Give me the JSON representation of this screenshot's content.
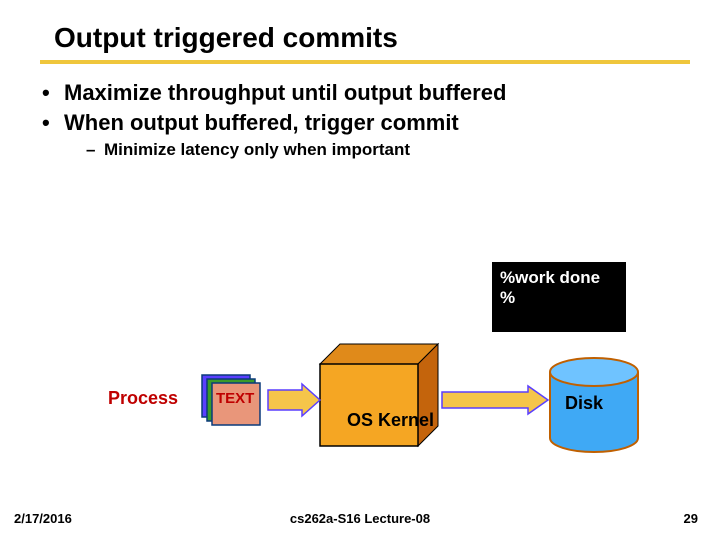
{
  "title": "Output triggered commits",
  "bullets": {
    "l1": [
      "Maximize throughput until output buffered",
      "When output buffered, trigger commit"
    ],
    "l2": [
      "Minimize latency only when important"
    ]
  },
  "badge": {
    "line1": "%work done",
    "line2": "%"
  },
  "diagram": {
    "process": "Process",
    "text": "TEXT",
    "kernel": "OS Kernel",
    "disk": "Disk"
  },
  "footer": {
    "date": "2/17/2016",
    "center": "cs262a-S16 Lecture-08",
    "page": "29"
  }
}
